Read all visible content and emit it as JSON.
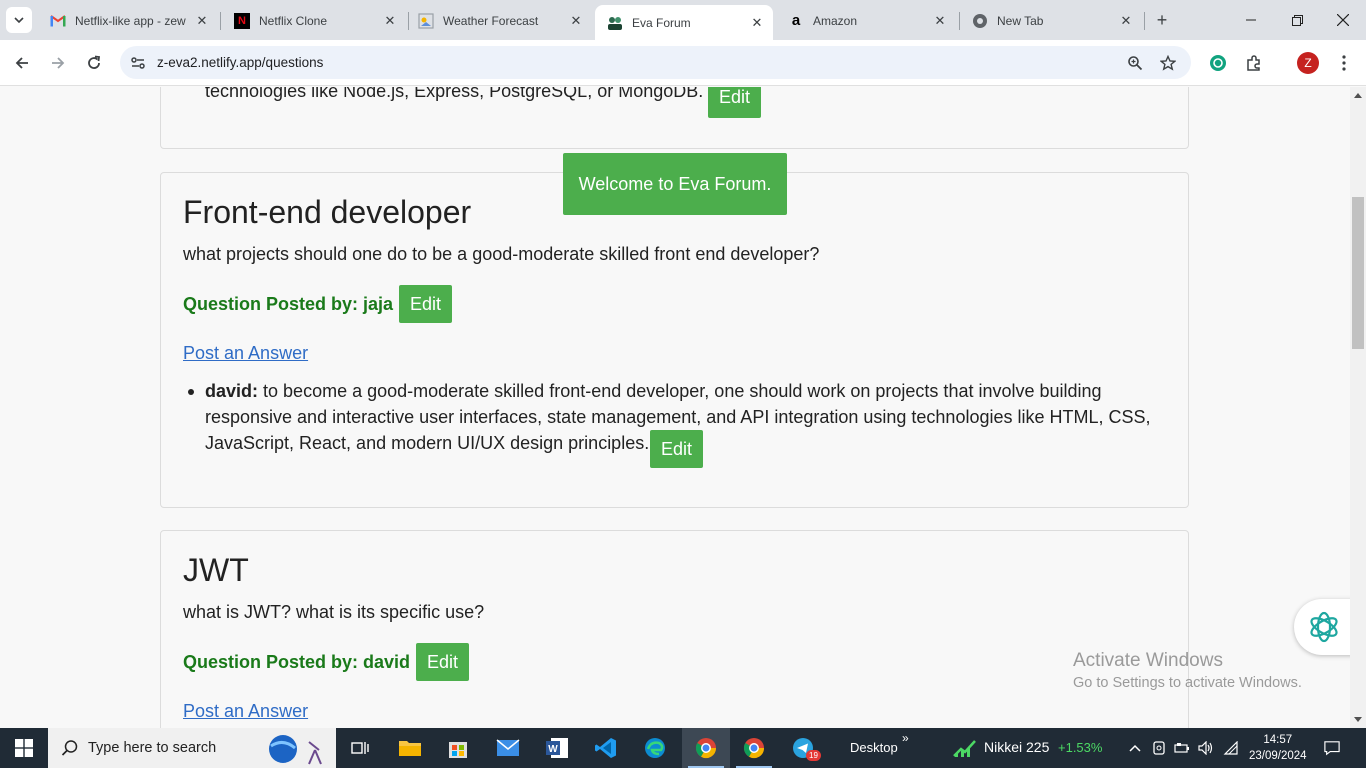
{
  "browser": {
    "tabs": [
      {
        "title": "Netflix-like app - zew",
        "icon": "gmail-icon",
        "active": false
      },
      {
        "title": "Netflix Clone",
        "icon": "netflix-icon",
        "active": false
      },
      {
        "title": "Weather Forecast",
        "icon": "weather-icon",
        "active": false
      },
      {
        "title": "Eva Forum",
        "icon": "forum-icon",
        "active": true
      },
      {
        "title": "Amazon",
        "icon": "amazon-icon",
        "active": false
      },
      {
        "title": "New Tab",
        "icon": "chrome-icon",
        "active": false
      }
    ],
    "url": "z-eva2.netlify.app/questions",
    "profile_initial": "Z"
  },
  "page": {
    "partial_card": {
      "answer_tail": "technologies like Node.js, Express, PostgreSQL, or MongoDB.",
      "edit_label": "Edit"
    },
    "toast": "Welcome to Eva Forum.",
    "questions": [
      {
        "title": "Front-end developer",
        "description": "what projects should one do to be a good-moderate skilled front end developer?",
        "posted_by": "Question Posted by: jaja",
        "edit_label": "Edit",
        "post_answer": "Post an Answer",
        "answers": [
          {
            "author": "david:",
            "text": "to become a good-moderate skilled front-end developer, one should work on projects that involve building responsive and interactive user interfaces, state management, and API integration using technologies like HTML, CSS, JavaScript, React, and modern UI/UX design principles.",
            "edit_label": "Edit"
          }
        ]
      },
      {
        "title": "JWT",
        "description": "what is JWT? what is its specific use?",
        "posted_by": "Question Posted by: david",
        "edit_label": "Edit",
        "post_answer": "Post an Answer"
      }
    ]
  },
  "watermark": {
    "line1": "Activate Windows",
    "line2": "Go to Settings to activate Windows."
  },
  "taskbar": {
    "search_placeholder": "Type here to search",
    "desktop_label": "Desktop",
    "desktop_chevron": "»",
    "stock_name": "Nikkei 225",
    "stock_change": "+1.53%",
    "time": "14:57",
    "date": "23/09/2024",
    "telegram_badge": "19",
    "colors": {
      "taskbar_bg": "#202b36",
      "stock_up": "#4cd964"
    }
  },
  "colors": {
    "edit_button": "#4cae4c",
    "posted_by_text": "#1a7a1a",
    "link": "#2f6cc6",
    "toast_bg": "#4cae4c"
  }
}
